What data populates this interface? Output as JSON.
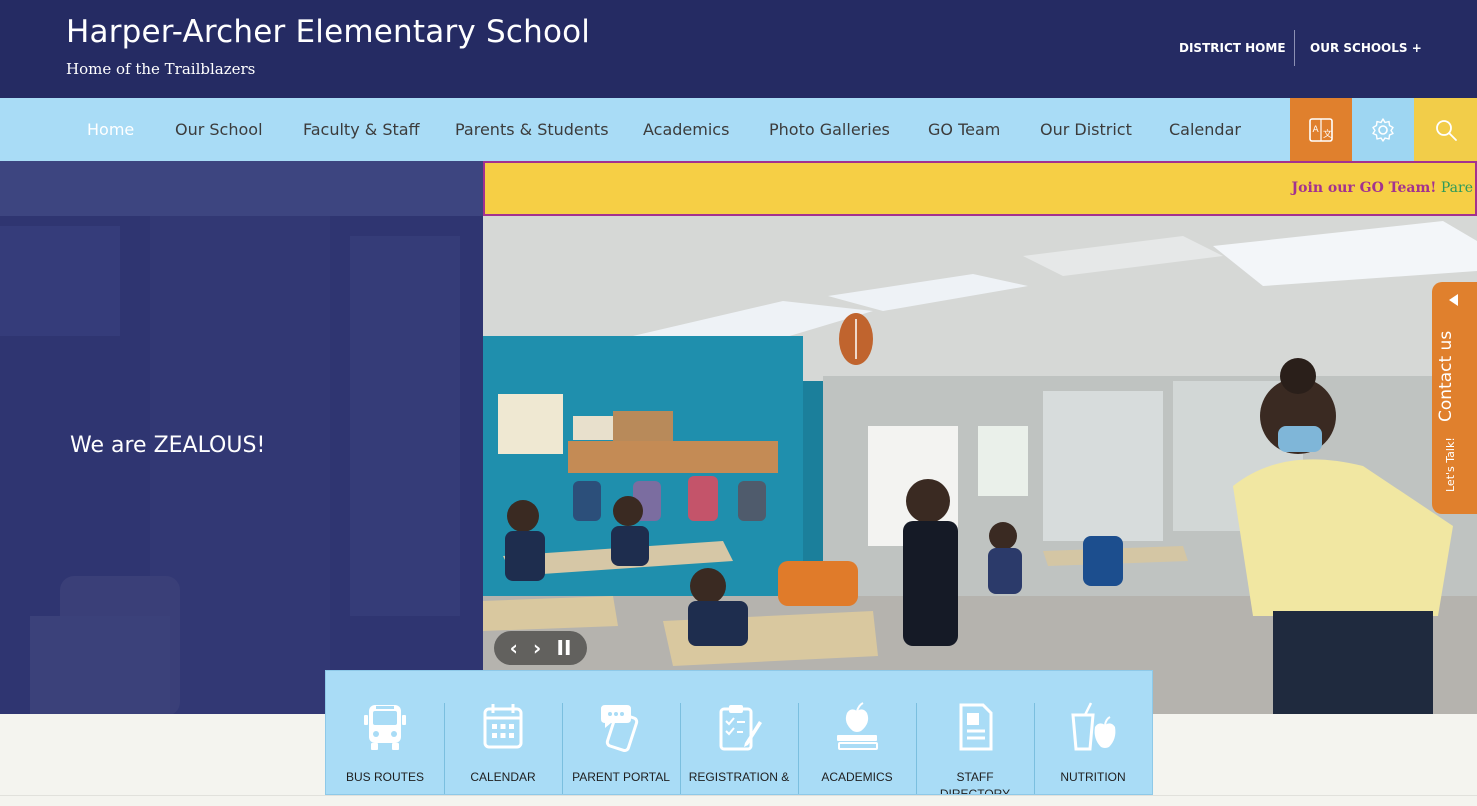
{
  "header": {
    "school_name": "Harper-Archer Elementary School",
    "tagline": "Home of the Trailblazers",
    "utility_links": [
      "DISTRICT HOME",
      "OUR SCHOOLS +"
    ]
  },
  "nav": {
    "items": [
      "Home",
      "Our School",
      "Faculty & Staff",
      "Parents & Students",
      "Academics",
      "Photo Galleries",
      "GO Team",
      "Our District",
      "Calendar"
    ],
    "tools": [
      "translate-icon",
      "gear-icon",
      "search-icon"
    ]
  },
  "alert": {
    "highlight": "Join our GO Team!",
    "more": "Pare"
  },
  "hero": {
    "caption": "We are ZEALOUS!",
    "controls": [
      "‹",
      "›",
      "II"
    ]
  },
  "contact_tab": {
    "label": "Contact us",
    "sub_label": "Let's Talk!"
  },
  "quick_links": [
    {
      "label": "BUS ROUTES",
      "icon": "bus-icon"
    },
    {
      "label": "CALENDAR",
      "icon": "calendar-icon"
    },
    {
      "label": "PARENT PORTAL",
      "icon": "phone-chat-icon"
    },
    {
      "label": "REGISTRATION &",
      "icon": "clipboard-icon"
    },
    {
      "label": "ACADEMICS",
      "icon": "apple-book-icon"
    },
    {
      "label": "STAFF DIRECTORY",
      "icon": "directory-icon"
    },
    {
      "label": "NUTRITION",
      "icon": "drink-apple-icon"
    }
  ],
  "colors": {
    "header_bg": "#252b63",
    "nav_bg": "#a9dcf6",
    "accent_orange": "#e0802d",
    "accent_yellow": "#f2cd49",
    "alert_border": "#a3328f"
  }
}
